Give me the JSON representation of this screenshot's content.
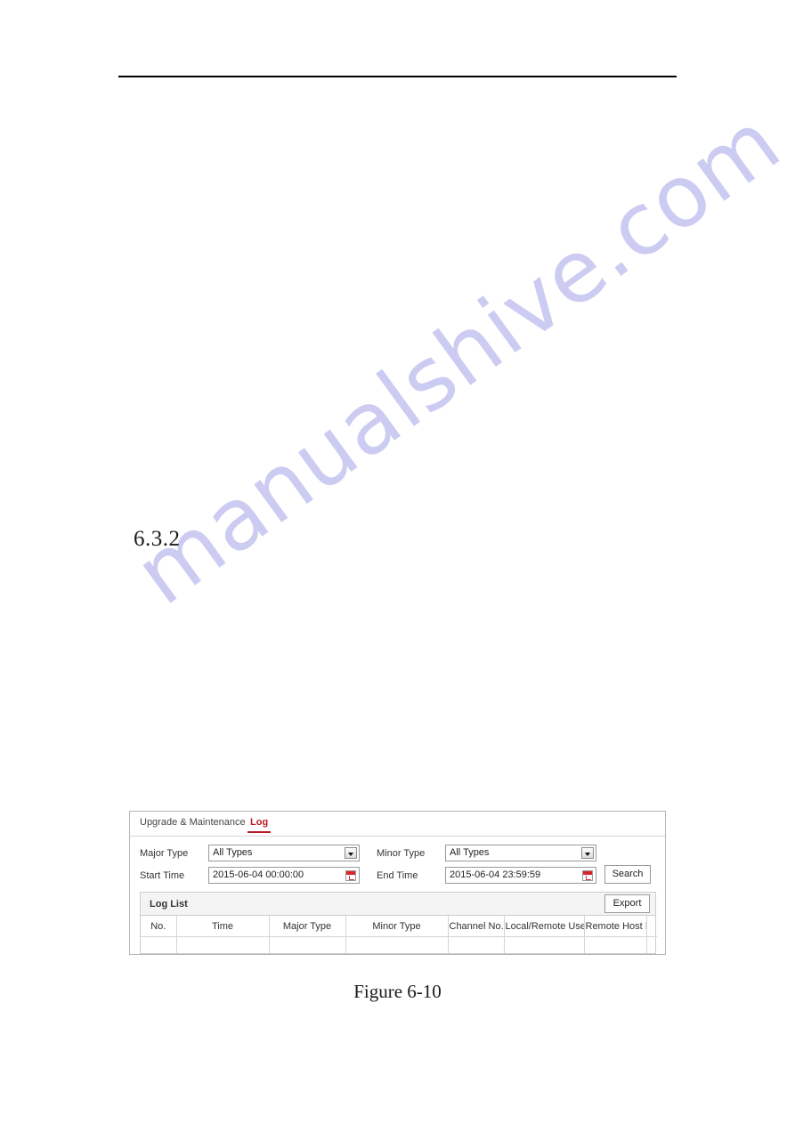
{
  "document": {
    "section_number": "6.3.2",
    "figure_caption": "Figure 6-10",
    "watermark": "manualshive.com"
  },
  "app": {
    "tabs": [
      {
        "label": "Upgrade & Maintenance",
        "active": false
      },
      {
        "label": "Log",
        "active": true
      }
    ],
    "accent_color": "#b81c22",
    "form": {
      "major_type": {
        "label": "Major Type",
        "value": "All Types"
      },
      "minor_type": {
        "label": "Minor Type",
        "value": "All Types"
      },
      "start_time": {
        "label": "Start Time",
        "value": "2015-06-04 00:00:00"
      },
      "end_time": {
        "label": "End Time",
        "value": "2015-06-04 23:59:59"
      },
      "search_button": "Search"
    },
    "log_list": {
      "title": "Log List",
      "export_button": "Export",
      "columns": [
        "No.",
        "Time",
        "Major Type",
        "Minor Type",
        "Channel No.",
        "Local/Remote User",
        "Remote Host IP",
        ""
      ],
      "rows": []
    }
  }
}
